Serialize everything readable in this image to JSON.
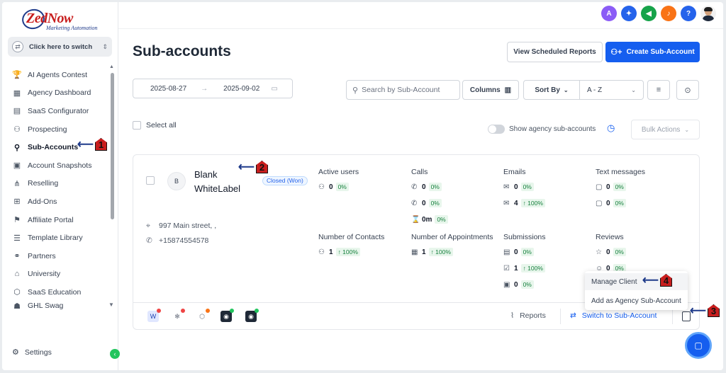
{
  "brand": {
    "name": "ZedNow",
    "tagline": "Marketing Automation"
  },
  "switcher": {
    "label": "Click here to switch"
  },
  "nav": [
    {
      "label": "AI Agents Contest",
      "icon": "trophy-icon",
      "glyph": "🏆"
    },
    {
      "label": "Agency Dashboard",
      "icon": "dashboard-icon",
      "glyph": "▦"
    },
    {
      "label": "SaaS Configurator",
      "icon": "chart-icon",
      "glyph": "▤"
    },
    {
      "label": "Prospecting",
      "icon": "people-icon",
      "glyph": "⚇"
    },
    {
      "label": "Sub-Accounts",
      "icon": "user-icon",
      "glyph": "👤",
      "active": true
    },
    {
      "label": "Account Snapshots",
      "icon": "snapshot-icon",
      "glyph": "▣"
    },
    {
      "label": "Reselling",
      "icon": "network-icon",
      "glyph": "⋔"
    },
    {
      "label": "Add-Ons",
      "icon": "plus-box-icon",
      "glyph": "⊞"
    },
    {
      "label": "Affiliate Portal",
      "icon": "affiliate-icon",
      "glyph": "⚑"
    },
    {
      "label": "Template Library",
      "icon": "library-icon",
      "glyph": "☰"
    },
    {
      "label": "Partners",
      "icon": "handshake-icon",
      "glyph": "⚭"
    },
    {
      "label": "University",
      "icon": "graduation-icon",
      "glyph": "🎓"
    },
    {
      "label": "SaaS Education",
      "icon": "education-icon",
      "glyph": "⬡"
    },
    {
      "label": "GHL Swag",
      "icon": "swag-icon",
      "glyph": "☗"
    }
  ],
  "settings": {
    "label": "Settings"
  },
  "topbar": {
    "icons": [
      {
        "name": "translate-icon",
        "color": "#8b5cf6",
        "glyph": "A"
      },
      {
        "name": "rocket-icon",
        "color": "#2563eb",
        "glyph": "✦"
      },
      {
        "name": "megaphone-icon",
        "color": "#16a34a",
        "glyph": "◀"
      },
      {
        "name": "bell-icon",
        "color": "#f97316",
        "glyph": "♪"
      },
      {
        "name": "help-icon",
        "color": "#2563eb",
        "glyph": "?"
      }
    ]
  },
  "page": {
    "title": "Sub-accounts",
    "view_reports_label": "View Scheduled Reports",
    "create_label": "Create Sub-Account"
  },
  "filters": {
    "date_start": "2025-08-27",
    "date_end": "2025-09-02",
    "search_placeholder": "Search by Sub-Account",
    "columns_label": "Columns",
    "sort_by_label": "Sort By",
    "sort_value": "A - Z"
  },
  "list": {
    "select_all_label": "Select all",
    "toggle_label": "Show agency sub-accounts",
    "bulk_actions_label": "Bulk Actions"
  },
  "account": {
    "initial": "B",
    "name": "Blank WhiteLabel",
    "status": "Closed (Won)",
    "address": "997 Main street, ,",
    "phone": "+15874554578",
    "metrics": {
      "active_users": {
        "title": "Active users",
        "rows": [
          {
            "value": "0",
            "pct": "0%"
          }
        ]
      },
      "calls": {
        "title": "Calls",
        "rows": [
          {
            "value": "0",
            "pct": "0%"
          },
          {
            "value": "0",
            "pct": "0%"
          },
          {
            "value": "0m",
            "pct": "0%"
          }
        ]
      },
      "emails": {
        "title": "Emails",
        "rows": [
          {
            "value": "0",
            "pct": "0%"
          },
          {
            "value": "4",
            "pct": "↑ 100%"
          }
        ]
      },
      "texts": {
        "title": "Text messages",
        "rows": [
          {
            "value": "0",
            "pct": "0%"
          },
          {
            "value": "0",
            "pct": "0%"
          }
        ]
      },
      "contacts": {
        "title": "Number of Contacts",
        "rows": [
          {
            "value": "1",
            "pct": "↑ 100%"
          }
        ]
      },
      "appointments": {
        "title": "Number of Appointments",
        "rows": [
          {
            "value": "1",
            "pct": "↑ 100%"
          }
        ]
      },
      "submissions": {
        "title": "Submissions",
        "rows": [
          {
            "value": "0",
            "pct": "0%"
          },
          {
            "value": "1",
            "pct": "↑ 100%"
          },
          {
            "value": "0",
            "pct": "0%"
          }
        ]
      },
      "reviews": {
        "title": "Reviews",
        "rows": [
          {
            "value": "0",
            "pct": "0%"
          },
          {
            "value": "0",
            "pct": "0%"
          }
        ]
      }
    },
    "reports_label": "Reports",
    "switch_label": "Switch to Sub-Account"
  },
  "menu": {
    "manage_label": "Manage Client",
    "add_agency_label": "Add as Agency Sub-Account"
  },
  "annotations": [
    "1",
    "2",
    "3",
    "4"
  ],
  "colors": {
    "primary": "#155eef",
    "success": "#16803d",
    "annotation": "#c81e1e"
  }
}
